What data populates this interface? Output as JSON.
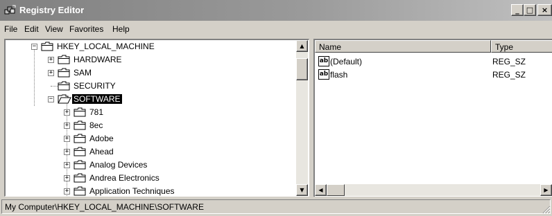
{
  "window": {
    "title": "Registry Editor",
    "min_label": "_",
    "max_label": "□",
    "close_label": "×"
  },
  "menu": [
    "File",
    "Edit",
    "View",
    "Favorites",
    "Help"
  ],
  "tree": {
    "root": "HKEY_LOCAL_MACHINE",
    "level1": [
      "HARDWARE",
      "SAM",
      "SECURITY",
      "SOFTWARE"
    ],
    "selected": "SOFTWARE",
    "software_children": [
      "781",
      "8ec",
      "Adobe",
      "Ahead",
      "Analog Devices",
      "Andrea Electronics",
      "Application Techniques"
    ]
  },
  "list": {
    "columns": [
      "Name",
      "Type"
    ],
    "rows": [
      {
        "name": "(Default)",
        "type": "REG_SZ",
        "icon": "ab-string-icon"
      },
      {
        "name": "flash",
        "type": "REG_SZ",
        "icon": "ab-string-icon"
      }
    ]
  },
  "scroll": {
    "up": "▲",
    "down": "▼",
    "left": "◀",
    "right": "▶"
  },
  "status": {
    "path": "My Computer\\HKEY_LOCAL_MACHINE\\SOFTWARE"
  },
  "colors": {
    "titlebar_start": "#808080",
    "titlebar_end": "#c0c0c0",
    "chrome": "#d4d0c8",
    "selection": "#000000"
  }
}
